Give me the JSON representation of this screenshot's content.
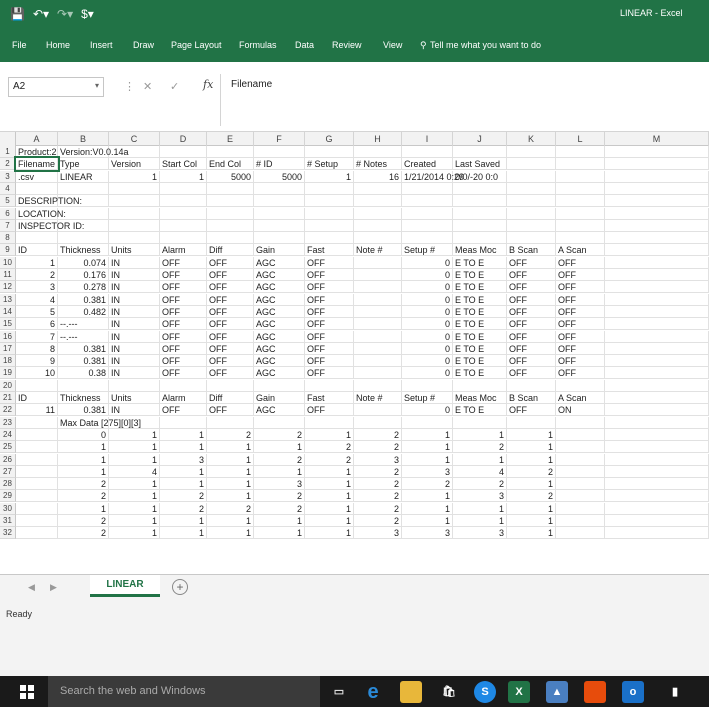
{
  "window": {
    "title": "LINEAR - Excel",
    "qat_icons": [
      "save-icon",
      "undo-icon",
      "redo-icon",
      "sensitivity-icon"
    ]
  },
  "ribbon": {
    "tabs": [
      "File",
      "Home",
      "Insert",
      "Draw",
      "Page Layout",
      "Formulas",
      "Data",
      "Review",
      "View"
    ],
    "tell_me": "Tell me what you want to do"
  },
  "formula_bar": {
    "name_box": "A2",
    "fx": "fx",
    "value": "Filename"
  },
  "columns": [
    "A",
    "B",
    "C",
    "D",
    "E",
    "F",
    "G",
    "H",
    "I",
    "J",
    "K",
    "L",
    "M"
  ],
  "rows": [
    [
      "Product:2",
      "Version:V0.0.14a",
      "",
      "",
      "",
      "",
      "",
      "",
      "",
      "",
      "",
      "",
      ""
    ],
    [
      "Filename",
      "Type",
      "Version",
      "Start Col",
      "End Col",
      "# ID",
      "# Setup",
      "# Notes",
      "Created",
      "Last Saved",
      "",
      "",
      ""
    ],
    [
      ".csv",
      "LINEAR",
      "1",
      "1",
      "5000",
      "5000",
      "1",
      "16",
      "1/21/2014 0:29",
      "0/0/-20 0:0",
      "",
      "",
      ""
    ],
    [
      "",
      "",
      "",
      "",
      "",
      "",
      "",
      "",
      "",
      "",
      "",
      "",
      ""
    ],
    [
      "DESCRIPTION:",
      "",
      "",
      "",
      "",
      "",
      "",
      "",
      "",
      "",
      "",
      "",
      ""
    ],
    [
      "LOCATION:",
      "",
      "",
      "",
      "",
      "",
      "",
      "",
      "",
      "",
      "",
      "",
      ""
    ],
    [
      "INSPECTOR ID:",
      "",
      "",
      "",
      "",
      "",
      "",
      "",
      "",
      "",
      "",
      "",
      ""
    ],
    [
      "",
      "",
      "",
      "",
      "",
      "",
      "",
      "",
      "",
      "",
      "",
      "",
      ""
    ],
    [
      "ID",
      "Thickness",
      "Units",
      "Alarm",
      "Diff",
      "Gain",
      "Fast",
      "Note #",
      "Setup #",
      "Meas Moc",
      "B Scan",
      "A Scan",
      ""
    ],
    [
      "1",
      "0.074",
      "IN",
      "OFF",
      "OFF",
      "AGC",
      "OFF",
      "",
      "0",
      "E TO E",
      "OFF",
      "OFF",
      ""
    ],
    [
      "2",
      "0.176",
      "IN",
      "OFF",
      "OFF",
      "AGC",
      "OFF",
      "",
      "0",
      "E TO E",
      "OFF",
      "OFF",
      ""
    ],
    [
      "3",
      "0.278",
      "IN",
      "OFF",
      "OFF",
      "AGC",
      "OFF",
      "",
      "0",
      "E TO E",
      "OFF",
      "OFF",
      ""
    ],
    [
      "4",
      "0.381",
      "IN",
      "OFF",
      "OFF",
      "AGC",
      "OFF",
      "",
      "0",
      "E TO E",
      "OFF",
      "OFF",
      ""
    ],
    [
      "5",
      "0.482",
      "IN",
      "OFF",
      "OFF",
      "AGC",
      "OFF",
      "",
      "0",
      "E TO E",
      "OFF",
      "OFF",
      ""
    ],
    [
      "6",
      "--.---",
      "IN",
      "OFF",
      "OFF",
      "AGC",
      "OFF",
      "",
      "0",
      "E TO E",
      "OFF",
      "OFF",
      ""
    ],
    [
      "7",
      "--.---",
      "IN",
      "OFF",
      "OFF",
      "AGC",
      "OFF",
      "",
      "0",
      "E TO E",
      "OFF",
      "OFF",
      ""
    ],
    [
      "8",
      "0.381",
      "IN",
      "OFF",
      "OFF",
      "AGC",
      "OFF",
      "",
      "0",
      "E TO E",
      "OFF",
      "OFF",
      ""
    ],
    [
      "9",
      "0.381",
      "IN",
      "OFF",
      "OFF",
      "AGC",
      "OFF",
      "",
      "0",
      "E TO E",
      "OFF",
      "OFF",
      ""
    ],
    [
      "10",
      "0.38",
      "IN",
      "OFF",
      "OFF",
      "AGC",
      "OFF",
      "",
      "0",
      "E TO E",
      "OFF",
      "OFF",
      ""
    ],
    [
      "",
      "",
      "",
      "",
      "",
      "",
      "",
      "",
      "",
      "",
      "",
      "",
      ""
    ],
    [
      "ID",
      "Thickness",
      "Units",
      "Alarm",
      "Diff",
      "Gain",
      "Fast",
      "Note #",
      "Setup #",
      "Meas Moc",
      "B Scan",
      "A Scan",
      ""
    ],
    [
      "11",
      "0.381",
      "IN",
      "OFF",
      "OFF",
      "AGC",
      "OFF",
      "",
      "0",
      "E TO E",
      "OFF",
      "ON",
      ""
    ],
    [
      "",
      "Max Data [275][0][3]",
      "",
      "",
      "",
      "",
      "",
      "",
      "",
      "",
      "",
      "",
      ""
    ],
    [
      "",
      "0",
      "1",
      "1",
      "2",
      "2",
      "1",
      "2",
      "1",
      "1",
      "1",
      "",
      ""
    ],
    [
      "",
      "1",
      "1",
      "1",
      "1",
      "1",
      "2",
      "2",
      "1",
      "2",
      "1",
      "",
      ""
    ],
    [
      "",
      "1",
      "1",
      "3",
      "1",
      "2",
      "2",
      "3",
      "1",
      "1",
      "1",
      "",
      ""
    ],
    [
      "",
      "1",
      "4",
      "1",
      "1",
      "1",
      "1",
      "2",
      "3",
      "4",
      "2",
      "",
      ""
    ],
    [
      "",
      "2",
      "1",
      "1",
      "1",
      "3",
      "1",
      "2",
      "2",
      "2",
      "1",
      "",
      ""
    ],
    [
      "",
      "2",
      "1",
      "2",
      "1",
      "2",
      "1",
      "2",
      "1",
      "3",
      "2",
      "",
      ""
    ],
    [
      "",
      "1",
      "1",
      "2",
      "2",
      "2",
      "1",
      "2",
      "1",
      "1",
      "1",
      "",
      ""
    ],
    [
      "",
      "2",
      "1",
      "1",
      "1",
      "1",
      "1",
      "2",
      "1",
      "1",
      "1",
      "",
      ""
    ],
    [
      "",
      "2",
      "1",
      "1",
      "1",
      "1",
      "1",
      "3",
      "3",
      "3",
      "1",
      "",
      ""
    ]
  ],
  "sheet_tabs": [
    "LINEAR"
  ],
  "status": "Ready",
  "taskbar": {
    "search_placeholder": "Search the web and Windows",
    "icons": [
      "task-view-icon",
      "edge-icon",
      "file-explorer-icon",
      "store-icon",
      "skype-icon",
      "excel-icon",
      "photos-icon",
      "office-icon",
      "outlook-icon",
      "clapper-icon"
    ]
  },
  "colors": {
    "accent": "#217346"
  }
}
